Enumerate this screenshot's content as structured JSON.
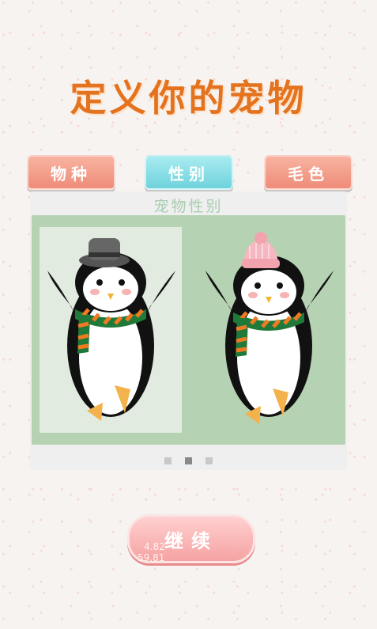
{
  "page": {
    "title": "定义你的宠物"
  },
  "tabs": [
    {
      "label": "物种",
      "active": false
    },
    {
      "label": "性别",
      "active": true
    },
    {
      "label": "毛色",
      "active": false
    }
  ],
  "panel": {
    "title": "宠物性别",
    "options": [
      {
        "id": "male",
        "accessory": "top-hat",
        "selected": true
      },
      {
        "id": "female",
        "accessory": "knit-beanie",
        "selected": false
      }
    ],
    "pager": {
      "count": 3,
      "active_index": 1
    }
  },
  "continue_button": {
    "label": "继续"
  },
  "debug_overlay": {
    "line1": "4.82",
    "line2": "59.81"
  },
  "colors": {
    "title": "#e4731f",
    "tab_inactive": "#ee8c79",
    "tab_active": "#6fd2dc",
    "panel_green": "#b5d2b2",
    "continue": "#f6a2a2"
  }
}
